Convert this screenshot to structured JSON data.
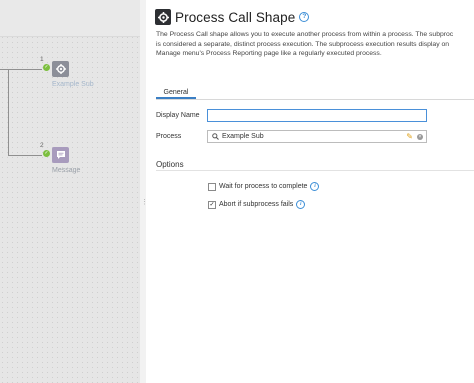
{
  "canvas": {
    "shapes": [
      {
        "step": "1",
        "label": "Example Sub",
        "icon": "process-call-icon"
      },
      {
        "step": "2",
        "label": "Message",
        "icon": "message-icon"
      }
    ]
  },
  "dialog": {
    "title": "Process Call Shape",
    "help_icon": "?",
    "description_lines": [
      "The Process Call shape allows you to execute another process from within a process. The subproc",
      "is considered a separate, distinct process execution. The subprocess execution results display on",
      "Manage menu's Process Reporting page like a regularly executed process."
    ],
    "tabs": [
      {
        "label": "General",
        "active": true
      }
    ],
    "fields": {
      "display_name": {
        "label": "Display Name",
        "value": "",
        "placeholder": ""
      },
      "process": {
        "label": "Process",
        "value": "Example Sub"
      }
    },
    "options_title": "Options",
    "options": [
      {
        "label": "Wait for process to complete",
        "checked": false
      },
      {
        "label": "Abort if subprocess fails",
        "checked": true
      }
    ],
    "colors": {
      "accent": "#3b7fc4",
      "focus_border": "#4a90d9",
      "success": "#7cbf3f"
    }
  }
}
